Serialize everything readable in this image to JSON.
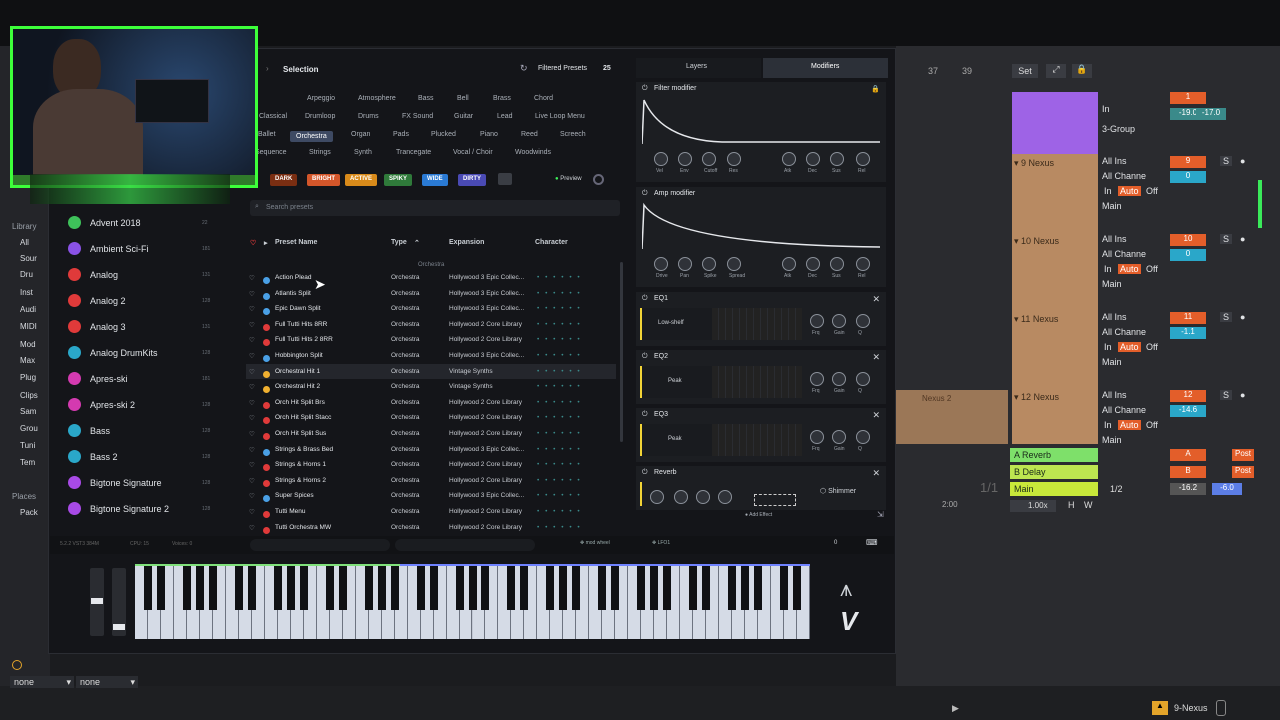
{
  "header": {
    "selection_label": "Selection",
    "filtered_presets_label": "Filtered Presets",
    "filtered_count": "25",
    "layers_tab": "Layers",
    "modifiers_tab": "Modifiers"
  },
  "categories": [
    "Arpeggio",
    "Atmosphere",
    "Bass",
    "Bell",
    "Brass",
    "Chord",
    "Classical",
    "Drumloop",
    "Drums",
    "FX Sound",
    "Guitar",
    "Lead",
    "Live Loop Menu",
    "Ballet",
    "Orchestra",
    "Organ",
    "Pads",
    "Plucked",
    "Piano",
    "Reed",
    "Screech",
    "Sequence",
    "Strings",
    "Synth",
    "Trancegate",
    "Vocal / Choir",
    "Woodwinds"
  ],
  "selected_category": "Orchestra",
  "moods": [
    "DARK",
    "BRIGHT",
    "ACTIVE",
    "SPIKY",
    "WIDE",
    "DIRTY"
  ],
  "preview_label": "Preview",
  "search": {
    "placeholder": "Search presets"
  },
  "table_headers": {
    "name": "Preset Name",
    "type": "Type",
    "expansion": "Expansion",
    "character": "Character"
  },
  "group_header": "Orchestra",
  "presets": [
    {
      "name": "Action Plead",
      "type": "Orchestra",
      "expansion": "Hollywood 3 Epic Collec...",
      "color": "#4aa0e6"
    },
    {
      "name": "Atlantis Split",
      "type": "Orchestra",
      "expansion": "Hollywood 3 Epic Collec...",
      "color": "#4aa0e6"
    },
    {
      "name": "Epic Dawn Split",
      "type": "Orchestra",
      "expansion": "Hollywood 3 Epic Collec...",
      "color": "#4aa0e6"
    },
    {
      "name": "Full Tutti Hits 8RR",
      "type": "Orchestra",
      "expansion": "Hollywood 2 Core Library",
      "color": "#e03a3a"
    },
    {
      "name": "Full Tutti Hits 2 8RR",
      "type": "Orchestra",
      "expansion": "Hollywood 2 Core Library",
      "color": "#e03a3a"
    },
    {
      "name": "Hobbington Split",
      "type": "Orchestra",
      "expansion": "Hollywood 3 Epic Collec...",
      "color": "#4aa0e6"
    },
    {
      "name": "Orchestral Hit 1",
      "type": "Orchestra",
      "expansion": "Vintage Synths",
      "color": "#f0b030"
    },
    {
      "name": "Orchestral Hit 2",
      "type": "Orchestra",
      "expansion": "Vintage Synths",
      "color": "#f0b030"
    },
    {
      "name": "Orch Hit Split Brs",
      "type": "Orchestra",
      "expansion": "Hollywood 2 Core Library",
      "color": "#e03a3a"
    },
    {
      "name": "Orch Hit Split Stacc",
      "type": "Orchestra",
      "expansion": "Hollywood 2 Core Library",
      "color": "#e03a3a"
    },
    {
      "name": "Orch Hit Split Sus",
      "type": "Orchestra",
      "expansion": "Hollywood 2 Core Library",
      "color": "#e03a3a"
    },
    {
      "name": "Strings & Brass Bed",
      "type": "Orchestra",
      "expansion": "Hollywood 3 Epic Collec...",
      "color": "#4aa0e6"
    },
    {
      "name": "Strings & Horns 1",
      "type": "Orchestra",
      "expansion": "Hollywood 2 Core Library",
      "color": "#e03a3a"
    },
    {
      "name": "Strings & Horns 2",
      "type": "Orchestra",
      "expansion": "Hollywood 2 Core Library",
      "color": "#e03a3a"
    },
    {
      "name": "Super Spices",
      "type": "Orchestra",
      "expansion": "Hollywood 3 Epic Collec...",
      "color": "#4aa0e6"
    },
    {
      "name": "Tutti Menu",
      "type": "Orchestra",
      "expansion": "Hollywood 2 Core Library",
      "color": "#e03a3a"
    },
    {
      "name": "Tutti Orchestra MW",
      "type": "Orchestra",
      "expansion": "Hollywood 2 Core Library",
      "color": "#e03a3a"
    }
  ],
  "expansions": [
    {
      "name": "Advent 2018",
      "count": "22",
      "color": "#3ec15a"
    },
    {
      "name": "Ambient Sci-Fi",
      "count": "181",
      "color": "#8a52e6"
    },
    {
      "name": "Analog",
      "count": "131",
      "color": "#e03a3a"
    },
    {
      "name": "Analog 2",
      "count": "128",
      "color": "#e03a3a"
    },
    {
      "name": "Analog 3",
      "count": "131",
      "color": "#e03a3a"
    },
    {
      "name": "Analog DrumKits",
      "count": "128",
      "color": "#2aa7c9"
    },
    {
      "name": "Apres-ski",
      "count": "181",
      "color": "#d43ab0"
    },
    {
      "name": "Apres-ski 2",
      "count": "128",
      "color": "#d43ab0"
    },
    {
      "name": "Bass",
      "count": "128",
      "color": "#2aa7c9"
    },
    {
      "name": "Bass 2",
      "count": "128",
      "color": "#2aa7c9"
    },
    {
      "name": "Bigtone Signature",
      "count": "128",
      "color": "#a84ae6"
    },
    {
      "name": "Bigtone Signature 2",
      "count": "128",
      "color": "#a84ae6"
    }
  ],
  "modifiers": {
    "filter": {
      "title": "Filter modifier",
      "knobs": [
        "Vel",
        "Env",
        "Cutoff",
        "Res",
        "Atk",
        "Dec",
        "Sus",
        "Rel"
      ]
    },
    "amp": {
      "title": "Amp modifier",
      "knobs": [
        "Drive",
        "Pan",
        "Spike",
        "Spread",
        "Atk",
        "Dec",
        "Sus",
        "Rel"
      ]
    },
    "eq1": {
      "title": "EQ1",
      "mode": "Low-shelf",
      "knobs": [
        "Frq",
        "Gain",
        "Q"
      ]
    },
    "eq2": {
      "title": "EQ2",
      "mode": "Peak",
      "knobs": [
        "Frq",
        "Gain",
        "Q"
      ]
    },
    "eq3": {
      "title": "EQ3",
      "mode": "Peak",
      "knobs": [
        "Frq",
        "Gain",
        "Q"
      ]
    },
    "reverb": {
      "title": "Reverb",
      "preset": "Shimmer"
    },
    "add_effect": "Add Effect"
  },
  "statusbar": {
    "left": "5.2.2 VST3 384M",
    "cpu": "CPU: 15",
    "voices": "Voices: 0",
    "mod_wheel": "mod wheel",
    "lfo": "LFO1",
    "value": "0"
  },
  "ableton": {
    "left_nav": [
      "Library",
      "All",
      "Sour",
      "Dru",
      "Inst",
      "Audi",
      "MIDI",
      "Mod",
      "Max",
      "Plug",
      "Clips",
      "Sam",
      "Grou",
      "Tuni",
      "Tem",
      "Places",
      "Pack"
    ],
    "bar_numbers": [
      "37",
      "39"
    ],
    "set_label": "Set",
    "tracks": [
      {
        "name": "3-Group",
        "num": "1",
        "vol": "-19.0",
        "pan": "-17.0"
      },
      {
        "name": "9 Nexus",
        "num": "9",
        "vol": "0"
      },
      {
        "name": "10 Nexus",
        "num": "10",
        "vol": "0"
      },
      {
        "name": "11 Nexus",
        "num": "11",
        "vol": "-1.1"
      },
      {
        "name": "12 Nexus",
        "num": "12",
        "vol": "-14.6"
      }
    ],
    "clip_label": "Nexus 2",
    "return_tracks": [
      {
        "name": "A Reverb",
        "letter": "A",
        "post": "Post"
      },
      {
        "name": "B Delay",
        "letter": "B",
        "post": "Post"
      },
      {
        "name": "Main",
        "letter": "1/2",
        "vol": "-16.2",
        "vol2": "-6.0"
      }
    ],
    "input_label": "All Ins",
    "channel_label": "All Channe",
    "auto_label": "Auto",
    "off_label": "Off",
    "in_label": "In",
    "main_label": "Main",
    "time_pos": "1/1",
    "time_label": "2:00",
    "zoom": "1.00x",
    "bottom_none_1": "none",
    "bottom_none_2": "none",
    "selected_track": "9-Nexus"
  }
}
